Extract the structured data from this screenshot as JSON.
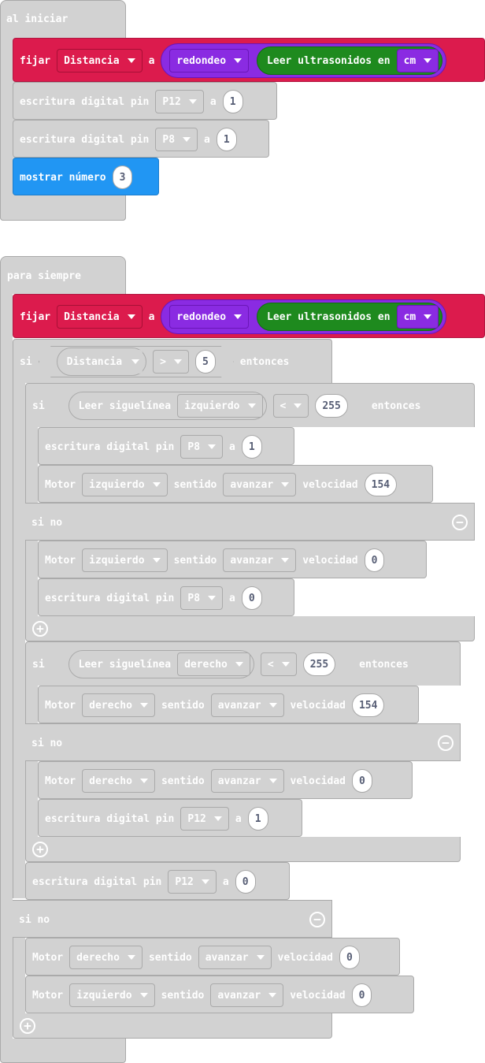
{
  "on_start": {
    "hat_label": "al iniciar",
    "set_block": {
      "verb": "fijar",
      "variable": "Distancia",
      "to": "a",
      "round": "redondeo",
      "read": "Leer ultrasonidos en",
      "unit": "cm"
    },
    "digital1": {
      "label": "escritura digital pin",
      "pin": "P12",
      "to": "a",
      "value": "1"
    },
    "digital2": {
      "label": "escritura digital pin",
      "pin": "P8",
      "to": "a",
      "value": "1"
    },
    "show_number": {
      "label": "mostrar número",
      "value": "3"
    }
  },
  "forever": {
    "hat_label": "para siempre",
    "set_block": {
      "verb": "fijar",
      "variable": "Distancia",
      "to": "a",
      "round": "redondeo",
      "read": "Leer ultrasonidos en",
      "unit": "cm"
    },
    "if_outer": {
      "si": "si",
      "var": "Distancia",
      "op": ">",
      "value": "5",
      "then": "entonces",
      "else": "si no"
    },
    "if_left": {
      "si": "si",
      "read": "Leer siguelínea",
      "side": "izquierdo",
      "op": "<",
      "value": "255",
      "then": "entonces",
      "else": "si no"
    },
    "left_then_digital": {
      "label": "escritura digital pin",
      "pin": "P8",
      "to": "a",
      "value": "1"
    },
    "left_then_motor": {
      "motor": "Motor",
      "side": "izquierdo",
      "dir_label": "sentido",
      "dir": "avanzar",
      "speed_label": "velocidad",
      "speed": "154"
    },
    "left_else_motor": {
      "motor": "Motor",
      "side": "izquierdo",
      "dir_label": "sentido",
      "dir": "avanzar",
      "speed_label": "velocidad",
      "speed": "0"
    },
    "left_else_digital": {
      "label": "escritura digital pin",
      "pin": "P8",
      "to": "a",
      "value": "0"
    },
    "if_right": {
      "si": "si",
      "read": "Leer siguelínea",
      "side": "derecho",
      "op": "<",
      "value": "255",
      "then": "entonces",
      "else": "si no"
    },
    "right_then_motor": {
      "motor": "Motor",
      "side": "derecho",
      "dir_label": "sentido",
      "dir": "avanzar",
      "speed_label": "velocidad",
      "speed": "154"
    },
    "right_else_motor": {
      "motor": "Motor",
      "side": "derecho",
      "dir_label": "sentido",
      "dir": "avanzar",
      "speed_label": "velocidad",
      "speed": "0"
    },
    "right_else_digital": {
      "label": "escritura digital pin",
      "pin": "P12",
      "to": "a",
      "value": "1"
    },
    "after_digital": {
      "label": "escritura digital pin",
      "pin": "P12",
      "to": "a",
      "value": "0"
    },
    "outer_else_motor1": {
      "motor": "Motor",
      "side": "derecho",
      "dir_label": "sentido",
      "dir": "avanzar",
      "speed_label": "velocidad",
      "speed": "0"
    },
    "outer_else_motor2": {
      "motor": "Motor",
      "side": "izquierdo",
      "dir_label": "sentido",
      "dir": "avanzar",
      "speed_label": "velocidad",
      "speed": "0"
    }
  }
}
